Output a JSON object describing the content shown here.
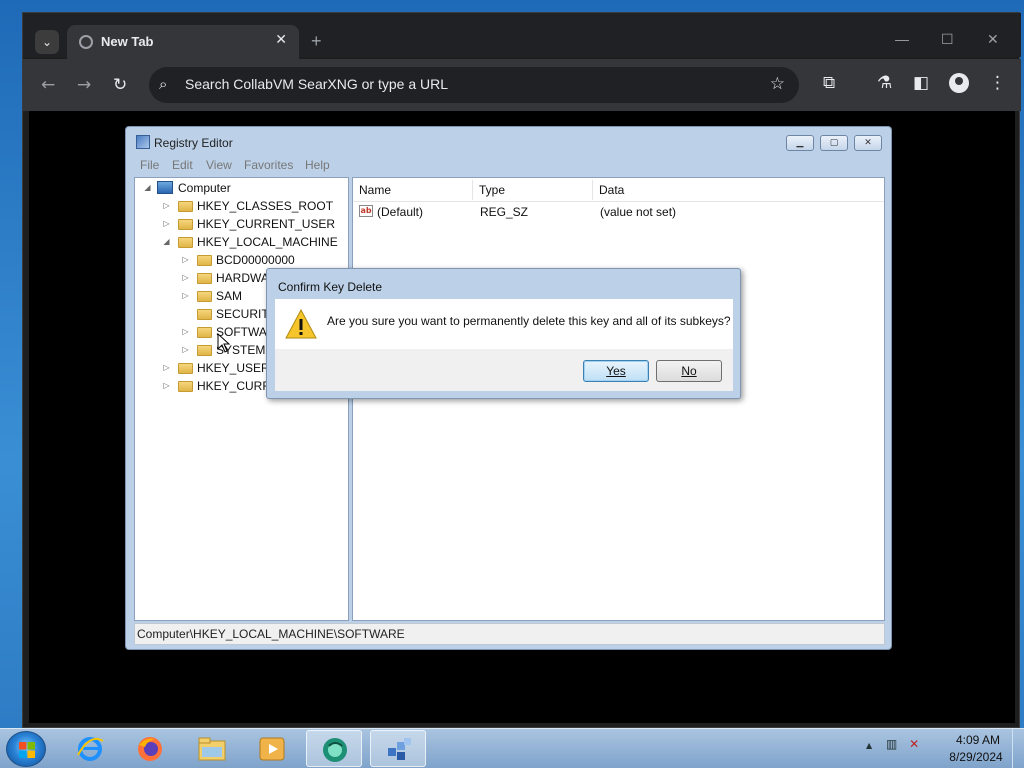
{
  "browser": {
    "tab_title": "New Tab",
    "tab_close": "✕",
    "new_tab": "+",
    "omnibox_placeholder": "Search CollabVM SearXNG or type a URL",
    "win_min": "—",
    "win_max": "☐",
    "win_close": "✕"
  },
  "regedit": {
    "title": "Registry Editor",
    "menu": [
      "File",
      "Edit",
      "View",
      "Favorites",
      "Help"
    ],
    "tree": {
      "root": "Computer",
      "hkcr": "HKEY_CLASSES_ROOT",
      "hkcu": "HKEY_CURRENT_USER",
      "hklm": "HKEY_LOCAL_MACHINE",
      "bcd": "BCD00000000",
      "hardware": "HARDWA",
      "sam": "SAM",
      "security": "SECURITY",
      "software": "SOFTWAR",
      "system": "SYSTEM",
      "hku": "HKEY_USERS",
      "hkcc": "HKEY_CURRE"
    },
    "columns": [
      "Name",
      "Type",
      "Data"
    ],
    "rows": [
      {
        "name": "(Default)",
        "type": "REG_SZ",
        "data": "(value not set)"
      }
    ],
    "status": "Computer\\HKEY_LOCAL_MACHINE\\SOFTWARE"
  },
  "dialog": {
    "title": "Confirm Key Delete",
    "message": "Are you sure you want to permanently delete this key and all of its subkeys?",
    "yes": "Yes",
    "no": "No"
  },
  "taskbar": {
    "time": "4:09 AM",
    "date": "8/29/2024",
    "tray_arrow": "▲"
  }
}
